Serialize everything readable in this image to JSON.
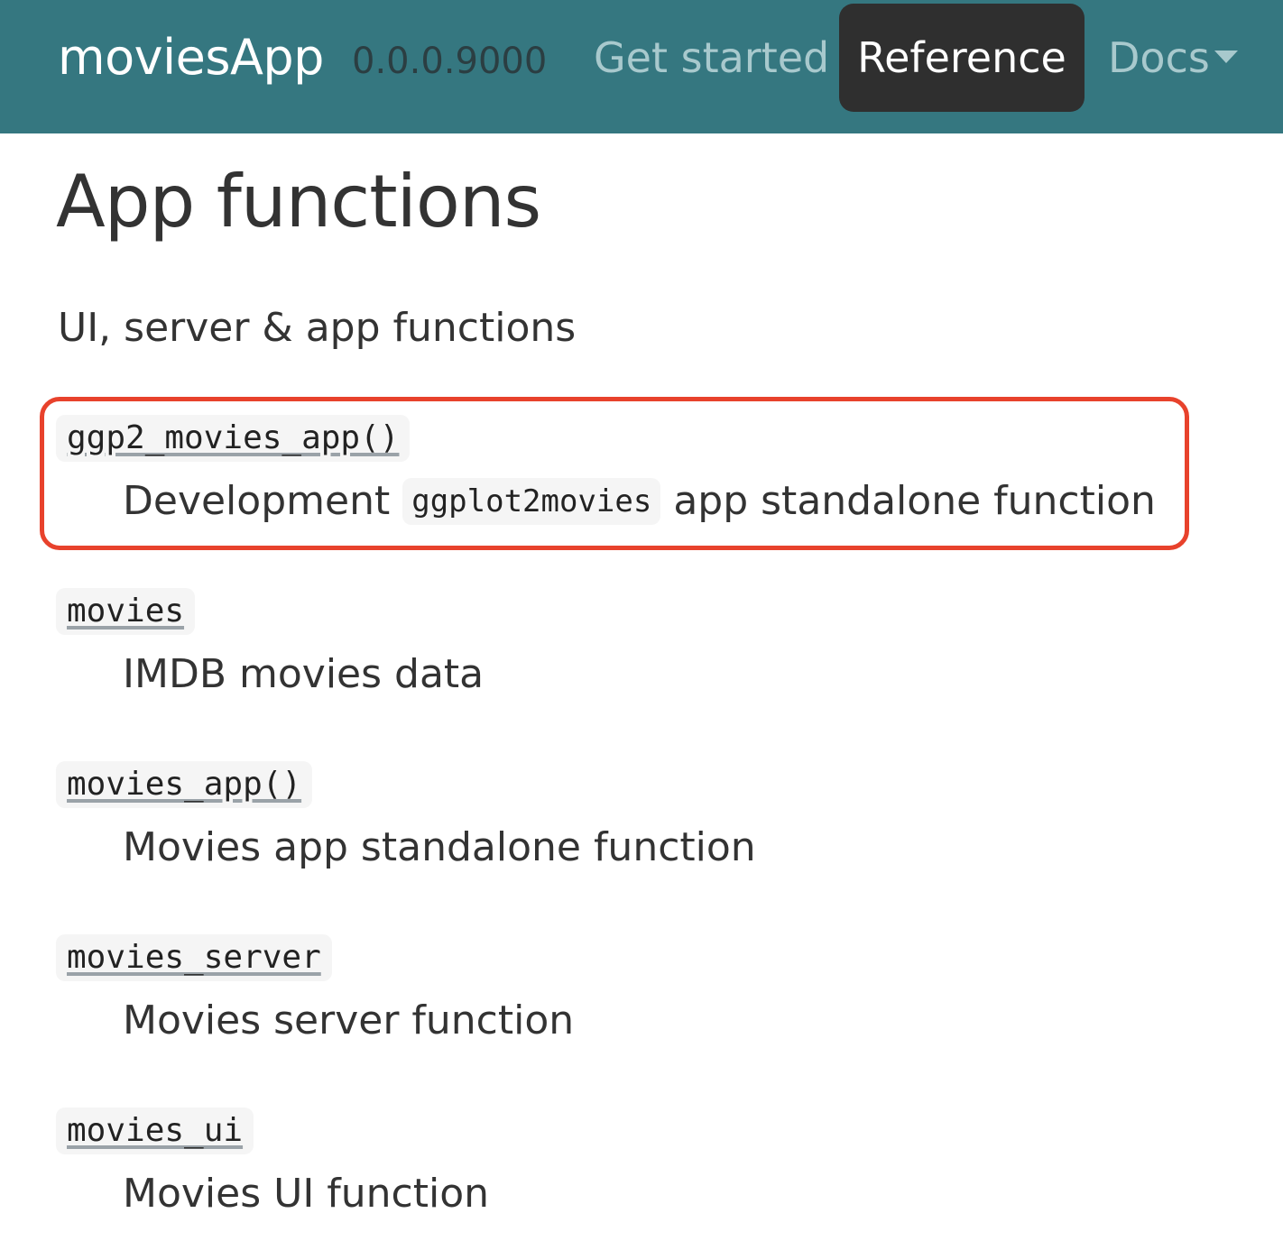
{
  "navbar": {
    "brand": "moviesApp",
    "version": "0.0.0.9000",
    "items": [
      {
        "label": "Get started"
      },
      {
        "label": "Reference",
        "active": true
      },
      {
        "label": "Docs"
      }
    ]
  },
  "main": {
    "title": "App functions",
    "subtitle": "UI, server & app functions",
    "entries": [
      {
        "code": "ggp2_movies_app()",
        "desc_before": "Development",
        "desc_code": "ggplot2movies",
        "desc_after": "app standalone function",
        "highlighted": true
      },
      {
        "code": "movies",
        "desc": "IMDB movies data"
      },
      {
        "code": "movies_app()",
        "desc": "Movies app standalone function"
      },
      {
        "code": "movies_server",
        "desc": "Movies server function"
      },
      {
        "code": "movies_ui",
        "desc": "Movies UI function"
      }
    ]
  },
  "colors": {
    "navbar_bg": "#357780",
    "active_bg": "#2f2f2f",
    "highlight": "#e8422c"
  },
  "icons": {
    "docs_dropdown": "caret-down-icon"
  }
}
